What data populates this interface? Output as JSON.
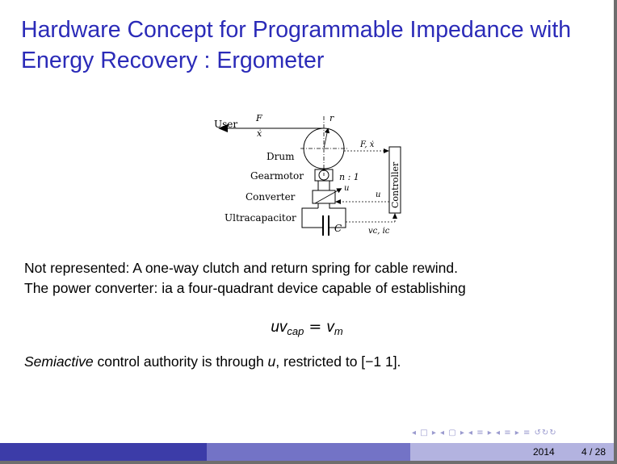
{
  "slide": {
    "title_line1": "Hardware Concept for Programmable Impedance with",
    "title_line2": "Energy Recovery : Ergometer",
    "body_line1": "Not represented: A one-way clutch and return spring for cable rewind.",
    "body_line2": "The power converter: ia a four-quadrant device capable of establishing",
    "equation": {
      "lhs_var": "uv",
      "lhs_sub": "cap",
      "op": "=",
      "rhs_var": "v",
      "rhs_sub": "m"
    },
    "line3": {
      "emph": "Semiactive",
      "text_a": " control authority is through ",
      "var": "u",
      "text_b": ", restricted to [−1 1]."
    }
  },
  "diagram": {
    "labels": {
      "user": "User",
      "force": "F",
      "xdot": "ẋ",
      "radius": "r",
      "drum": "Drum",
      "force_xdot": "F, ẋ",
      "controller": "Controller",
      "gearmotor": "Gearmotor",
      "ratio": "n : 1",
      "converter": "Converter",
      "u_converter": "u",
      "u_controller": "u",
      "ultracapacitor": "Ultracapacitor",
      "capacitance": "C",
      "vc_ic": "vᴄ, iᴄ"
    }
  },
  "navigation": {
    "symbols": "◂ □ ▸ ◂ ▢ ▸ ◂ ≡ ▸ ◂ ≡ ▸   ≡   ↺↻↻"
  },
  "footer": {
    "date": "2014",
    "page": "4 / 28"
  },
  "colors": {
    "title": "#2b2bb8",
    "footer_dark": "#3c3ca8",
    "footer_mid": "#7373c6",
    "footer_light": "#b3b3e0"
  }
}
